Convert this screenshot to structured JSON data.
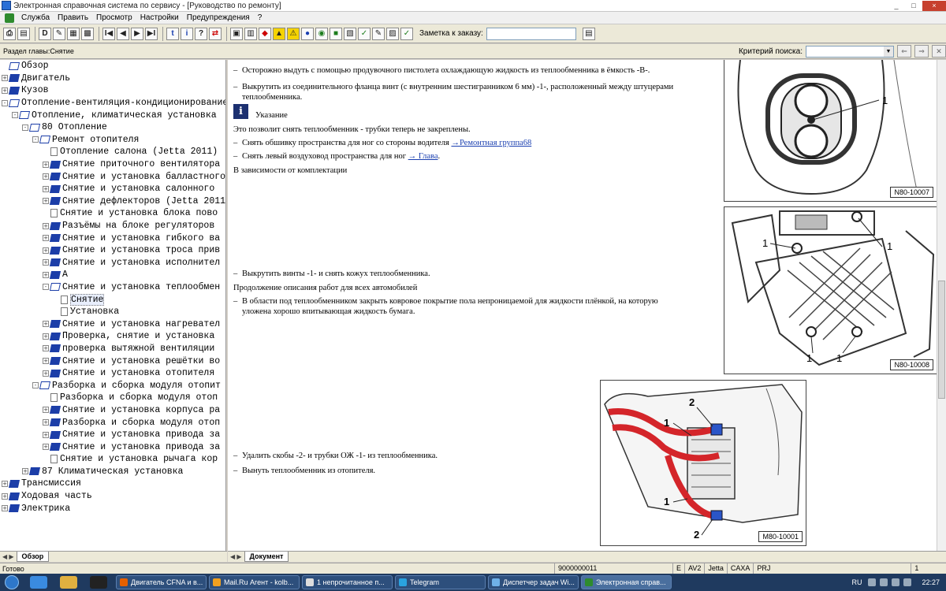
{
  "window": {
    "title": "Электронная справочная система по сервису - [Руководство по ремонту]",
    "controls": [
      "_",
      "□",
      "×"
    ]
  },
  "menu": [
    "Служба",
    "Править",
    "Просмотр",
    "Настройки",
    "Предупреждения",
    "?"
  ],
  "toolbar": {
    "buttons": [
      "⎙",
      "▤",
      "D",
      "✎",
      "▦",
      "▩",
      "I◀",
      "◀",
      "▶",
      "▶I",
      "t",
      "i",
      "?",
      "⇄",
      "▣",
      "▥",
      "◆",
      "▲",
      "⚠",
      "●",
      "◉",
      "■",
      "▧",
      "✓",
      "✎",
      "▨",
      "✓"
    ],
    "note_label": "Заметка к заказу:",
    "note_value": ""
  },
  "sectionbar": {
    "label": "Раздел главы:Снятие",
    "criteria_label": "Критерий поиска:",
    "criteria_value": ""
  },
  "tree": [
    {
      "label": "Обзор",
      "exp": "",
      "icon": "book-open",
      "level": 0
    },
    {
      "label": "Двигатель",
      "exp": "+",
      "icon": "book",
      "level": 0
    },
    {
      "label": "Кузов",
      "exp": "+",
      "icon": "book",
      "level": 0
    },
    {
      "label": "Отопление-вентиляция-кондиционирование",
      "exp": "-",
      "icon": "book-open",
      "level": 0
    },
    {
      "label": "Отопление, климатическая установка",
      "exp": "-",
      "icon": "book-open",
      "level": 1
    },
    {
      "label": "80 Отопление",
      "exp": "-",
      "icon": "book-open",
      "level": 2
    },
    {
      "label": "Ремонт отопителя",
      "exp": "-",
      "icon": "book-open",
      "level": 3
    },
    {
      "label": "Отопление салона (Jetta 2011)",
      "exp": "",
      "icon": "doc",
      "level": 4
    },
    {
      "label": "Снятие приточного вентилятора",
      "exp": "+",
      "icon": "book",
      "level": 4
    },
    {
      "label": "Снятие и установка балластного",
      "exp": "+",
      "icon": "book",
      "level": 4
    },
    {
      "label": "Снятие и установка салонного",
      "exp": "+",
      "icon": "book",
      "level": 4
    },
    {
      "label": "Снятие дефлекторов (Jetta 2011",
      "exp": "+",
      "icon": "book",
      "level": 4
    },
    {
      "label": "Снятие и установка блока пово",
      "exp": "",
      "icon": "doc",
      "level": 4
    },
    {
      "label": "Разъёмы на блоке регуляторов",
      "exp": "+",
      "icon": "book",
      "level": 4
    },
    {
      "label": "Снятие и установка гибкого ва",
      "exp": "+",
      "icon": "book",
      "level": 4
    },
    {
      "label": "Снятие и установка троса прив",
      "exp": "+",
      "icon": "book",
      "level": 4
    },
    {
      "label": "Снятие и установка исполнител",
      "exp": "+",
      "icon": "book",
      "level": 4
    },
    {
      "label": "A",
      "exp": "+",
      "icon": "book",
      "level": 4
    },
    {
      "label": "Снятие и установка теплообмен",
      "exp": "-",
      "icon": "book-open",
      "level": 4
    },
    {
      "label": "Снятие",
      "exp": "",
      "icon": "doc",
      "level": 5,
      "selected": true
    },
    {
      "label": "Установка",
      "exp": "",
      "icon": "doc",
      "level": 5
    },
    {
      "label": "Снятие и установка нагревател",
      "exp": "+",
      "icon": "book",
      "level": 4
    },
    {
      "label": "Проверка, снятие и установка",
      "exp": "+",
      "icon": "book",
      "level": 4
    },
    {
      "label": "проверка вытяжной вентиляции",
      "exp": "+",
      "icon": "book",
      "level": 4
    },
    {
      "label": "Снятие и установка решётки во",
      "exp": "+",
      "icon": "book",
      "level": 4
    },
    {
      "label": "Снятие и установка отопителя",
      "exp": "+",
      "icon": "book",
      "level": 4
    },
    {
      "label": "Разборка и сборка модуля отопит",
      "exp": "-",
      "icon": "book-open",
      "level": 3
    },
    {
      "label": "Разборка и сборка модуля отоп",
      "exp": "",
      "icon": "doc",
      "level": 4
    },
    {
      "label": "Снятие и установка корпуса ра",
      "exp": "+",
      "icon": "book",
      "level": 4
    },
    {
      "label": "Разборка и сборка модуля отоп",
      "exp": "+",
      "icon": "book",
      "level": 4
    },
    {
      "label": "Снятие и установка привода за",
      "exp": "+",
      "icon": "book",
      "level": 4
    },
    {
      "label": "Снятие и установка привода за",
      "exp": "+",
      "icon": "book",
      "level": 4
    },
    {
      "label": "Снятие и установка рычага кор",
      "exp": "",
      "icon": "doc",
      "level": 4
    },
    {
      "label": "87 Климатическая установка",
      "exp": "+",
      "icon": "book",
      "level": 2
    },
    {
      "label": "Трансмиссия",
      "exp": "+",
      "icon": "book",
      "level": 0
    },
    {
      "label": "Ходовая часть",
      "exp": "+",
      "icon": "book",
      "level": 0
    },
    {
      "label": "Электрика",
      "exp": "+",
      "icon": "book",
      "level": 0
    }
  ],
  "tree_tab": "Обзор",
  "doc_tab": "Документ",
  "content": {
    "step1": "Осторожно выдуть с помощью продувочного пистолета охлаждающую жидкость из теплообменника в ёмкость -B-.",
    "step2a": "Выкрутить из соединительного фланца винт (с внутренним шестигранником 6 мм) -1-, расположенный между штуцерами",
    "step2b": "теплообменника.",
    "note_title": "Указание",
    "note_text": "Это позволит снять теплообменник - трубки теперь не закреплены.",
    "step3": "Снять обшивку пространства для ног со стороны водителя ",
    "step3_link": "→Ремонтная группа68",
    "step4": "Снять левый воздуховод пространства для ног ",
    "step4_link": "→ Глава",
    "step4_end": ".",
    "dep": "В зависимости от комплектации",
    "step5": "Выкрутить винты -1- и снять кожух теплообменника.",
    "cont": "Продолжение описания работ для всех автомобилей",
    "step6a": "В области под теплообменником закрыть ковровое покрытие пола непроницаемой для жидкости плёнкой, на которую",
    "step6b": "уложена хорошо впитывающая жидкость бумага.",
    "step7": "Удалить скобы -2- и трубки ОЖ -1- из теплообменника.",
    "step8": "Вынуть теплообменник из отопителя.",
    "dash": "–",
    "info_letter": "i"
  },
  "figures": {
    "fig1_code": "N80-10007",
    "fig1_label": "1",
    "fig2_code": "N80-10008",
    "fig2_labels": [
      "1",
      "1",
      "1",
      "1"
    ],
    "fig3_code": "M80-10001",
    "fig3_labels": [
      "2",
      "1",
      "1",
      "2"
    ]
  },
  "status": {
    "text": "Готово",
    "code": "9000000011",
    "cells": [
      "E",
      "AV2",
      "Jetta",
      "CAXA",
      "PRJ",
      "1"
    ]
  },
  "taskbar": {
    "tasks": [
      "Двигатель CFNA и в...",
      "Mail.Ru Агент - kolb...",
      "1 непрочитанное п...",
      "Telegram",
      "Диспетчер задач Wi...",
      "Электронная справ..."
    ],
    "lang": "RU",
    "clock": "22:27"
  },
  "colors": {
    "link": "#1a3fb0",
    "tube_red": "#d4252a",
    "bracket_blue": "#2a55c8",
    "taskbar": "#1f3a5f"
  }
}
